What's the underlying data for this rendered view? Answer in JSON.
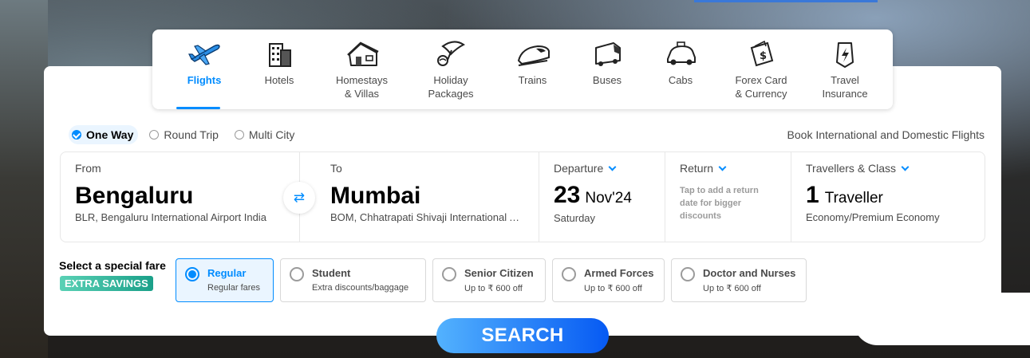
{
  "nav": {
    "items": [
      {
        "label": "Flights",
        "icon": "airplane-icon",
        "active": true
      },
      {
        "label": "Hotels",
        "icon": "hotel-building-icon"
      },
      {
        "label": "Homestays & Villas",
        "icon": "house-icon"
      },
      {
        "label": "Holiday Packages",
        "icon": "beach-umbrella-icon"
      },
      {
        "label": "Trains",
        "icon": "train-icon"
      },
      {
        "label": "Buses",
        "icon": "bus-icon"
      },
      {
        "label": "Cabs",
        "icon": "car-icon"
      },
      {
        "label": "Forex Card & Currency",
        "icon": "forex-card-icon"
      },
      {
        "label": "Travel Insurance",
        "icon": "insurance-shield-icon"
      }
    ]
  },
  "trip_types": [
    {
      "label": "One Way",
      "selected": true
    },
    {
      "label": "Round Trip",
      "selected": false
    },
    {
      "label": "Multi City",
      "selected": false
    }
  ],
  "book_text": "Book International and Domestic Flights",
  "from": {
    "label": "From",
    "city": "Bengaluru",
    "airport": "BLR, Bengaluru International Airport India"
  },
  "to": {
    "label": "To",
    "city": "Mumbai",
    "airport": "BOM, Chhatrapati Shivaji International Airport India"
  },
  "departure": {
    "label": "Departure",
    "day": "23",
    "month": "Nov'24",
    "weekday": "Saturday"
  },
  "return": {
    "label": "Return",
    "hint": "Tap to add a return date for bigger discounts"
  },
  "travellers": {
    "label": "Travellers & Class",
    "count": "1",
    "unit": "Traveller",
    "class": "Economy/Premium Economy"
  },
  "special_fare": {
    "label": "Select a special fare",
    "badge": "EXTRA SAVINGS",
    "options": [
      {
        "title": "Regular",
        "sub": "Regular fares",
        "selected": true
      },
      {
        "title": "Student",
        "sub": "Extra discounts/baggage"
      },
      {
        "title": "Senior Citizen",
        "sub": "Up to ₹ 600 off"
      },
      {
        "title": "Armed Forces",
        "sub": "Up to ₹ 600 off"
      },
      {
        "title": "Doctor and Nurses",
        "sub": "Up to ₹ 600 off"
      }
    ]
  },
  "search_label": "SEARCH",
  "colors": {
    "accent": "#008cff",
    "badge": "#1aa089"
  }
}
